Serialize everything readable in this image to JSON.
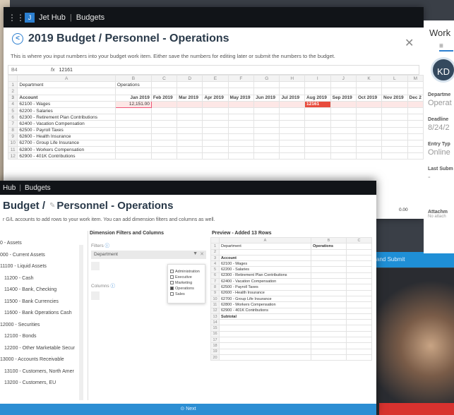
{
  "top": {
    "app": "Jet Hub",
    "section": "Budgets"
  },
  "win1": {
    "title": "2019 Budget / Personnel - Operations",
    "description": "This is where you input numbers into your budget work item. Either save the numbers for editing later or submit the numbers to the budget.",
    "cell_ref": "B4",
    "formula": "12161",
    "columns": [
      "A",
      "B",
      "C",
      "D",
      "E",
      "F",
      "G",
      "H",
      "I",
      "J",
      "K",
      "L",
      "M"
    ],
    "months": [
      "Jan 2019",
      "Feb 2019",
      "Mar 2019",
      "Apr 2019",
      "May 2019",
      "Jun 2019",
      "Jul 2019",
      "Aug 2019",
      "Sep 2019",
      "Oct 2019",
      "Nov 2019",
      "Dec 2"
    ],
    "r1a": "Department",
    "r1b": "Operations",
    "r3a": "Account",
    "accounts": [
      "62100 - Wages",
      "62200 - Salaries",
      "62300 - Retirement Plan Contributions",
      "62400 - Vacation Compensation",
      "62500 - Payroll Taxes",
      "62600 - Health Insurance",
      "62700 - Group Life Insurance",
      "62800 - Workers Compensation",
      "62900 - 401K Contributions"
    ],
    "wages_jan": "12,151.00",
    "wages_aug": "12161",
    "side_val": "0.00"
  },
  "panel": {
    "title": "Work",
    "avatar": "KD",
    "dept_label": "Departme",
    "dept_val": "Operat",
    "deadline_label": "Deadline",
    "deadline_val": "8/24/2",
    "entry_label": "Entry Typ",
    "entry_val": "Online",
    "last_label": "Last Subm",
    "last_val": "-",
    "attach_label": "Attachm",
    "attach_val": "No attach"
  },
  "bg": {
    "submit": "and Submit"
  },
  "win2": {
    "crumb_app": "Hub",
    "crumb_section": "Budgets",
    "title_a": "Budget /",
    "title_b": "Personnel - Operations",
    "description": "r G/L accounts to add rows to your work item. You can add dimension filters and columns as well.",
    "dim_header": "Dimension Filters and Columns",
    "filters_label": "Filters",
    "columns_label": "Columns",
    "info": "ⓘ",
    "filter_value": "Department",
    "options": [
      "Administration",
      "Executive",
      "Marketing",
      "Operations",
      "Sales"
    ],
    "tree": [
      "0 - Assets",
      "000 - Current Assets",
      "11100 - Liquid Assets",
      "11200 - Cash",
      "11400 - Bank, Checking",
      "11500 - Bank Currencies",
      "11600 - Bank Operations Cash",
      "12000 - Securities",
      "12100 - Bonds",
      "12200 - Other Marketable Secur",
      "13000 - Accounts Receivable",
      "13100 - Customers, North Amer",
      "13200 - Customers, EU"
    ],
    "preview_header": "Preview - Added 13 Rows",
    "pcols": [
      "A",
      "B",
      "C"
    ],
    "p1a": "Department",
    "p1b": "Operations",
    "p3a": "Account",
    "subtotal": "Subtotal",
    "next": "Next"
  }
}
